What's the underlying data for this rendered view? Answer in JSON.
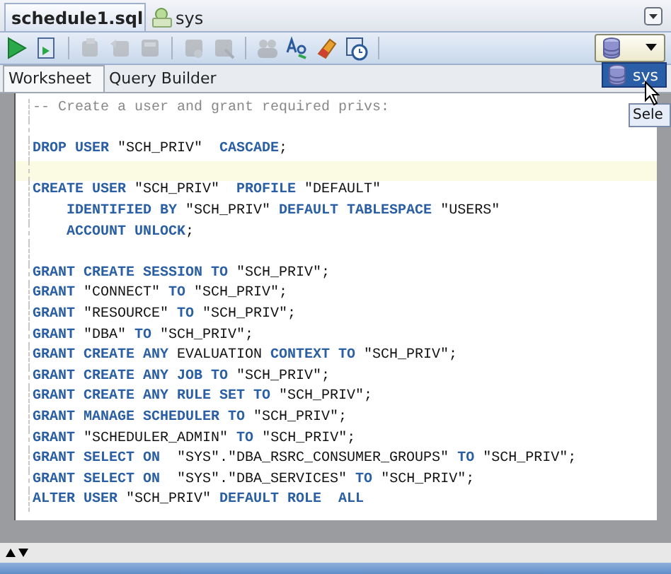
{
  "document_tabs": [
    {
      "label": "schedule1.sql",
      "selected": true
    },
    {
      "label": "sys",
      "selected": false
    }
  ],
  "toolbar": {
    "buttons": [
      {
        "disabled": false
      },
      {
        "disabled": false
      },
      {
        "disabled": true
      },
      {
        "disabled": true
      },
      {
        "disabled": true
      },
      {
        "disabled": true
      },
      {
        "disabled": true
      },
      {
        "disabled": true
      },
      {
        "disabled": false
      },
      {
        "disabled": false
      },
      {
        "disabled": false
      }
    ]
  },
  "connection_menu": {
    "items": [
      {
        "label": "sys",
        "selected": true
      }
    ]
  },
  "tooltip": {
    "text": "Sele"
  },
  "sub_tabs": [
    {
      "label": "Worksheet",
      "selected": true
    },
    {
      "label": "Query Builder",
      "selected": false
    }
  ],
  "editor": {
    "lines": [
      {
        "highlighted": false,
        "tokens": [
          {
            "kind": "comment",
            "text": "-- Create a user and grant required privs:"
          }
        ]
      },
      {
        "highlighted": false
      },
      {
        "highlighted": false,
        "tokens": [
          {
            "kind": "keyword",
            "text": "DROP USER"
          },
          {
            "kind": "plain",
            "text": " \"SCH_PRIV\"  "
          },
          {
            "kind": "keyword",
            "text": "CASCADE"
          },
          {
            "kind": "plain",
            "text": ";"
          }
        ]
      },
      {
        "highlighted": true
      },
      {
        "highlighted": false,
        "tokens": [
          {
            "kind": "keyword",
            "text": "CREATE USER"
          },
          {
            "kind": "plain",
            "text": " \"SCH_PRIV\"  "
          },
          {
            "kind": "keyword",
            "text": "PROFILE"
          },
          {
            "kind": "plain",
            "text": " \"DEFAULT\""
          }
        ],
        "children": [
          {
            "highlighted": false,
            "tokens": [
              {
                "kind": "keyword",
                "text": "IDENTIFIED BY"
              },
              {
                "kind": "plain",
                "text": " \"SCH_PRIV\" "
              },
              {
                "kind": "keyword",
                "text": "DEFAULT TABLESPACE"
              },
              {
                "kind": "plain",
                "text": " \"USERS\""
              }
            ]
          },
          {
            "highlighted": false,
            "tokens": [
              {
                "kind": "keyword",
                "text": "ACCOUNT UNLOCK"
              },
              {
                "kind": "plain",
                "text": ";"
              }
            ]
          }
        ]
      },
      {
        "highlighted": false
      },
      {
        "highlighted": false,
        "tokens": [
          {
            "kind": "keyword",
            "text": "GRANT CREATE SESSION TO"
          },
          {
            "kind": "plain",
            "text": " \"SCH_PRIV\";"
          }
        ]
      },
      {
        "highlighted": false,
        "tokens": [
          {
            "kind": "keyword",
            "text": "GRANT"
          },
          {
            "kind": "plain",
            "text": " \"CONNECT\" "
          },
          {
            "kind": "keyword",
            "text": "TO"
          },
          {
            "kind": "plain",
            "text": " \"SCH_PRIV\";"
          }
        ]
      },
      {
        "highlighted": false,
        "tokens": [
          {
            "kind": "keyword",
            "text": "GRANT"
          },
          {
            "kind": "plain",
            "text": " \"RESOURCE\" "
          },
          {
            "kind": "keyword",
            "text": "TO"
          },
          {
            "kind": "plain",
            "text": " \"SCH_PRIV\";"
          }
        ]
      },
      {
        "highlighted": false,
        "tokens": [
          {
            "kind": "keyword",
            "text": "GRANT"
          },
          {
            "kind": "plain",
            "text": " \"DBA\" "
          },
          {
            "kind": "keyword",
            "text": "TO"
          },
          {
            "kind": "plain",
            "text": " \"SCH_PRIV\";"
          }
        ]
      },
      {
        "highlighted": false,
        "tokens": [
          {
            "kind": "keyword",
            "text": "GRANT CREATE ANY"
          },
          {
            "kind": "plain",
            "text": " EVALUATION "
          },
          {
            "kind": "keyword",
            "text": "CONTEXT TO"
          },
          {
            "kind": "plain",
            "text": " \"SCH_PRIV\";"
          }
        ]
      },
      {
        "highlighted": false,
        "tokens": [
          {
            "kind": "keyword",
            "text": "GRANT CREATE ANY JOB TO"
          },
          {
            "kind": "plain",
            "text": " \"SCH_PRIV\";"
          }
        ]
      },
      {
        "highlighted": false,
        "tokens": [
          {
            "kind": "keyword",
            "text": "GRANT CREATE ANY RULE SET TO"
          },
          {
            "kind": "plain",
            "text": " \"SCH_PRIV\";"
          }
        ]
      },
      {
        "highlighted": false,
        "tokens": [
          {
            "kind": "keyword",
            "text": "GRANT MANAGE SCHEDULER TO"
          },
          {
            "kind": "plain",
            "text": " \"SCH_PRIV\";"
          }
        ]
      },
      {
        "highlighted": false,
        "tokens": [
          {
            "kind": "keyword",
            "text": "GRANT"
          },
          {
            "kind": "plain",
            "text": " \"SCHEDULER_ADMIN\" "
          },
          {
            "kind": "keyword",
            "text": "TO"
          },
          {
            "kind": "plain",
            "text": " \"SCH_PRIV\";"
          }
        ]
      },
      {
        "highlighted": false,
        "tokens": [
          {
            "kind": "keyword",
            "text": "GRANT SELECT ON"
          },
          {
            "kind": "plain",
            "text": "  \"SYS\".\"DBA_RSRC_CONSUMER_GROUPS\" "
          },
          {
            "kind": "keyword",
            "text": "TO"
          },
          {
            "kind": "plain",
            "text": " \"SCH_PRIV\";"
          }
        ]
      },
      {
        "highlighted": false,
        "tokens": [
          {
            "kind": "keyword",
            "text": "GRANT SELECT ON"
          },
          {
            "kind": "plain",
            "text": "  \"SYS\".\"DBA_SERVICES\" "
          },
          {
            "kind": "keyword",
            "text": "TO"
          },
          {
            "kind": "plain",
            "text": " \"SCH_PRIV\";"
          }
        ]
      },
      {
        "highlighted": false,
        "tokens": [
          {
            "kind": "keyword",
            "text": "ALTER USER"
          },
          {
            "kind": "plain",
            "text": " \"SCH_PRIV\" "
          },
          {
            "kind": "keyword",
            "text": "DEFAULT ROLE  ALL"
          }
        ]
      }
    ]
  }
}
